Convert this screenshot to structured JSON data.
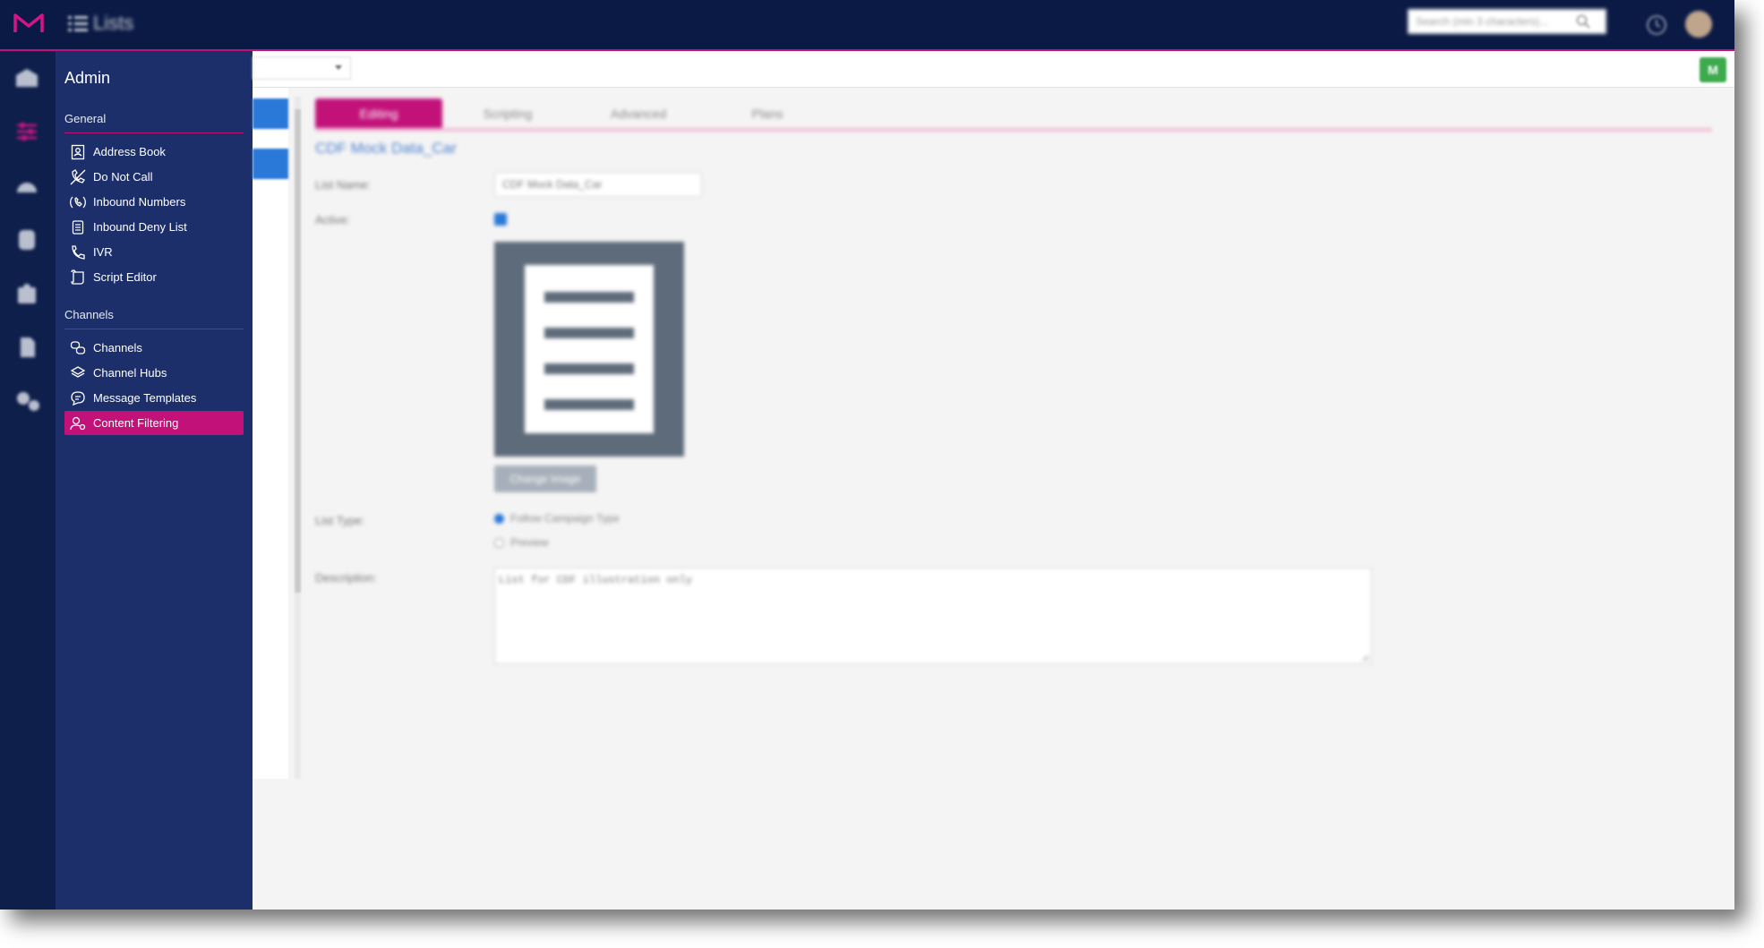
{
  "app": {
    "title": "Lists",
    "brand_color": "#c2127a",
    "topbar_color": "#0b1a45"
  },
  "search": {
    "placeholder": "Search (min 3 characters)..."
  },
  "sidebar": {
    "title": "Admin",
    "general": {
      "title": "General",
      "items": [
        {
          "label": "Address Book",
          "icon": "address-book-icon"
        },
        {
          "label": "Do Not Call",
          "icon": "do-not-call-icon"
        },
        {
          "label": "Inbound Numbers",
          "icon": "inbound-numbers-icon"
        },
        {
          "label": "Inbound Deny List",
          "icon": "inbound-deny-list-icon"
        },
        {
          "label": "IVR",
          "icon": "phone-icon"
        },
        {
          "label": "Script Editor",
          "icon": "script-icon"
        }
      ]
    },
    "channels": {
      "title": "Channels",
      "items": [
        {
          "label": "Channels",
          "icon": "channels-icon"
        },
        {
          "label": "Channel Hubs",
          "icon": "layers-icon"
        },
        {
          "label": "Message Templates",
          "icon": "message-icon"
        },
        {
          "label": "Content Filtering",
          "icon": "content-filtering-icon",
          "active": true
        }
      ]
    }
  },
  "toolbar": {
    "m_button_label": "M"
  },
  "tabs": [
    "Editing",
    "Scripting",
    "Advanced",
    "Plans"
  ],
  "form": {
    "heading": "CDF Mock Data_Car",
    "list_name_label": "List Name:",
    "list_name_value": "CDF Mock Data_Car",
    "active_label": "Active:",
    "active_checked": true,
    "change_image_label": "Change Image",
    "list_type_label": "List Type:",
    "list_type_options": [
      "Follow Campaign Type",
      "Preview"
    ],
    "list_type_selected": "Follow Campaign Type",
    "description_label": "Description:",
    "description_value": "List for CDF illustration only"
  }
}
